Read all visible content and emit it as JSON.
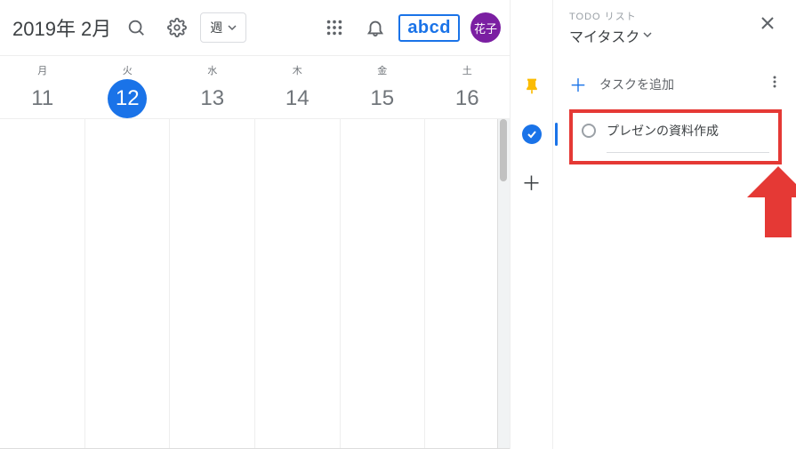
{
  "header": {
    "month_label": "2019年 2月",
    "view_label": "週",
    "brand": "abcd",
    "avatar_label": "花子"
  },
  "days": [
    {
      "dow": "月",
      "num": "11",
      "selected": false
    },
    {
      "dow": "火",
      "num": "12",
      "selected": true
    },
    {
      "dow": "水",
      "num": "13",
      "selected": false
    },
    {
      "dow": "木",
      "num": "14",
      "selected": false
    },
    {
      "dow": "金",
      "num": "15",
      "selected": false
    },
    {
      "dow": "土",
      "num": "16",
      "selected": false
    }
  ],
  "tasks_panel": {
    "subtitle": "TODO リスト",
    "list_name": "マイタスク",
    "add_label": "タスクを追加",
    "task0": "プレゼンの資料作成"
  }
}
